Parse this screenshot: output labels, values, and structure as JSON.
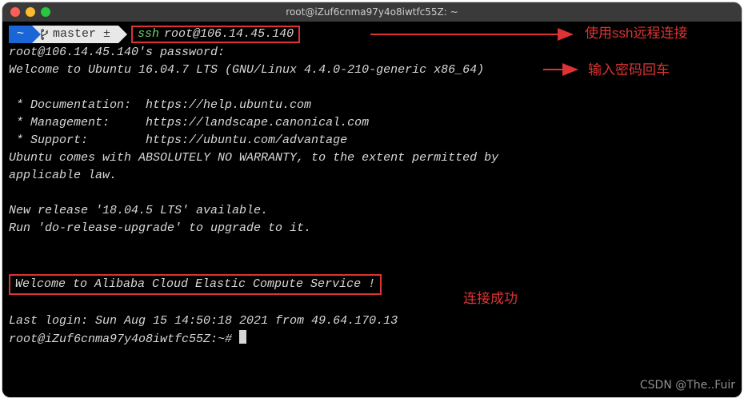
{
  "titlebar": {
    "title": "root@iZuf6cnma97y4o8iwtfc55Z: ~"
  },
  "prompt": {
    "home": "~",
    "branch": "master ±",
    "ssh": "ssh",
    "cmd_rest": "root@106.14.45.140"
  },
  "lines": {
    "pw": "root@106.14.45.140's password:",
    "welcome_ubuntu": "Welcome to Ubuntu 16.04.7 LTS (GNU/Linux 4.4.0-210-generic x86_64)",
    "doc": " * Documentation:  https://help.ubuntu.com",
    "mgmt": " * Management:     https://landscape.canonical.com",
    "supp": " * Support:        https://ubuntu.com/advantage",
    "warr1": "Ubuntu comes with ABSOLUTELY NO WARRANTY, to the extent permitted by",
    "warr2": "applicable law.",
    "rel1": "New release '18.04.5 LTS' available.",
    "rel2": "Run 'do-release-upgrade' to upgrade to it.",
    "alibaba": "Welcome to Alibaba Cloud Elastic Compute Service !",
    "last_login": "Last login: Sun Aug 15 14:50:18 2021 from 49.64.170.13",
    "shell_prompt": "root@iZuf6cnma97y4o8iwtfc55Z:~# "
  },
  "annotations": {
    "ssh_remote": "使用ssh远程连接",
    "enter_password": "输入密码回车",
    "connected": "连接成功"
  },
  "watermark": "CSDN @The..Fuir"
}
